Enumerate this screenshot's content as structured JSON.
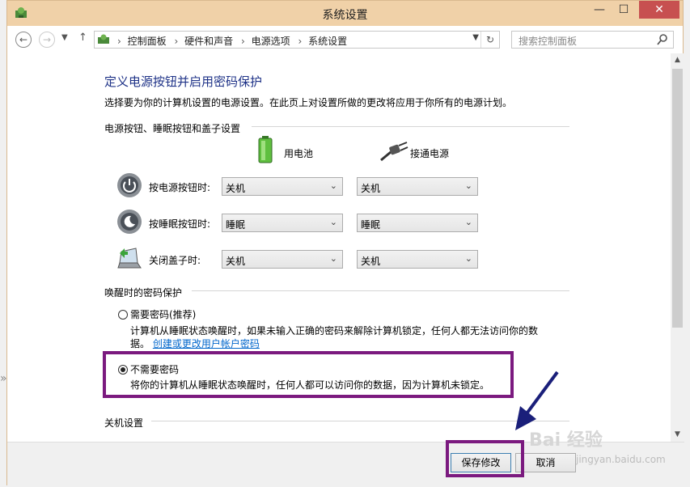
{
  "window": {
    "title": "系统设置"
  },
  "titlebar": {
    "min": "—",
    "max": "☐",
    "close": "✕"
  },
  "nav": {
    "back": "←",
    "forward": "→",
    "recent": "▼",
    "up": "↑",
    "breadcrumbs": [
      "控制面板",
      "硬件和声音",
      "电源选项",
      "系统设置"
    ],
    "crumb_sep": "›",
    "dropdown": "▼",
    "refresh": "↻",
    "search_placeholder": "搜索控制面板"
  },
  "page": {
    "heading": "定义电源按钮并启用密码保护",
    "description": "选择要为你的计算机设置的电源设置。在此页上对设置所做的更改将应用于你所有的电源计划。"
  },
  "power_section": {
    "title": "电源按钮、睡眠按钮和盖子设置",
    "col_battery": "用电池",
    "col_plugged": "接通电源",
    "rows": [
      {
        "label": "按电源按钮时:",
        "battery": "关机",
        "plugged": "关机"
      },
      {
        "label": "按睡眠按钮时:",
        "battery": "睡眠",
        "plugged": "睡眠"
      },
      {
        "label": "关闭盖子时:",
        "battery": "关机",
        "plugged": "关机"
      }
    ]
  },
  "password_section": {
    "title": "唤醒时的密码保护",
    "option1_label": "需要密码(推荐)",
    "option1_desc": "计算机从睡眠状态唤醒时，如果未输入正确的密码来解除计算机锁定，任何人都无法访问你的数",
    "option1_desc2": "据。",
    "option1_link": "创建或更改用户帐户密码",
    "option2_label": "不需要密码",
    "option2_desc": "将你的计算机从睡眠状态唤醒时，任何人都可以访问你的数据，因为计算机未锁定。"
  },
  "shutdown_section": {
    "title": "关机设置"
  },
  "footer": {
    "save": "保存修改",
    "cancel": "取消"
  },
  "scrollbar": {
    "up": "▲",
    "down": "▼"
  },
  "watermark": {
    "brand": "Bai 经验",
    "url": "jingyan.baidu.com"
  },
  "edge": {
    "glyph": "»"
  },
  "colors": {
    "titlebar": "#f0d1a8",
    "heading": "#1e3287",
    "highlight": "#7b1a7f",
    "link": "#0066cc"
  }
}
